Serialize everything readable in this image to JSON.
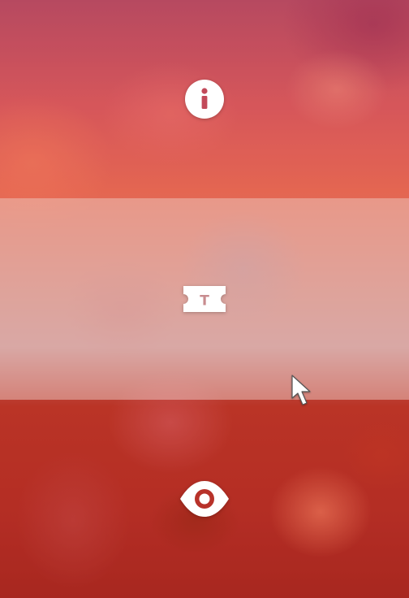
{
  "menu": {
    "items": [
      {
        "id": "info",
        "icon": "info-icon"
      },
      {
        "id": "tickets",
        "icon": "ticket-icon",
        "icon_letter": "T",
        "state": "hovered"
      },
      {
        "id": "watch",
        "icon": "eye-icon"
      }
    ]
  },
  "cursor": {
    "icon": "mouse-pointer-icon"
  },
  "colors": {
    "icon_fill": "#ffffff",
    "top_band": "#d85a5c",
    "middle_band_overlay": "#ebc8c3",
    "bottom_band": "#b8322a"
  }
}
